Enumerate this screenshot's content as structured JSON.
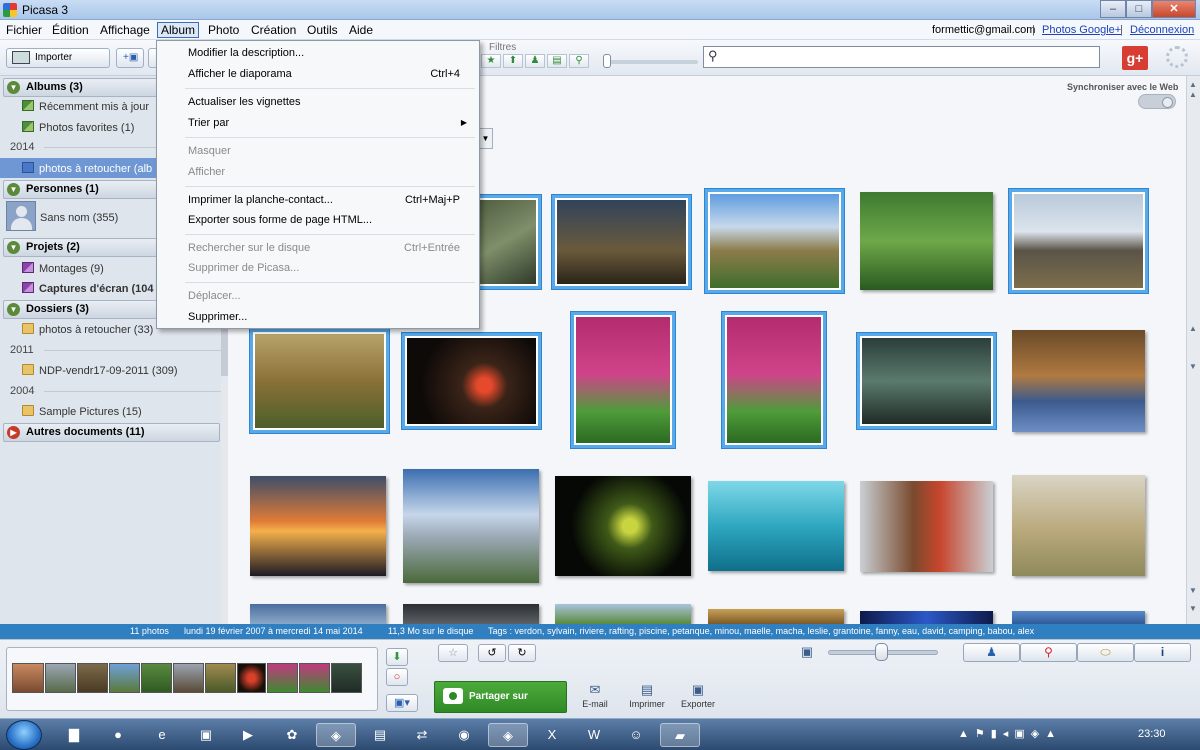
{
  "window": {
    "title": "Picasa 3"
  },
  "menubar": {
    "items": [
      "Fichier",
      "Édition",
      "Affichage",
      "Album",
      "Photo",
      "Création",
      "Outils",
      "Aide"
    ],
    "account_email": "formettic@gmail.com",
    "photos_google_link": "Photos Google+",
    "separator": "|",
    "logout_link": "Déconnexion"
  },
  "toolbar": {
    "import_label": "Importer",
    "filters_label": "Filtres",
    "search_placeholder": ""
  },
  "album_menu": {
    "items": [
      {
        "label": "Modifier la description...",
        "shortcut": "",
        "disabled": false
      },
      {
        "label": "Afficher le diaporama",
        "shortcut": "Ctrl+4",
        "disabled": false
      },
      {
        "label": "Actualiser les vignettes",
        "shortcut": "",
        "disabled": false
      },
      {
        "label": "Trier par",
        "shortcut": "",
        "disabled": false,
        "submenu": true
      },
      {
        "label": "Masquer",
        "shortcut": "",
        "disabled": true
      },
      {
        "label": "Afficher",
        "shortcut": "",
        "disabled": true
      },
      {
        "label": "Imprimer la planche-contact...",
        "shortcut": "Ctrl+Maj+P",
        "disabled": false
      },
      {
        "label": "Exporter sous forme de page HTML...",
        "shortcut": "",
        "disabled": false
      },
      {
        "label": "Rechercher sur le disque",
        "shortcut": "Ctrl+Entrée",
        "disabled": true
      },
      {
        "label": "Supprimer de Picasa...",
        "shortcut": "",
        "disabled": true
      },
      {
        "label": "Déplacer...",
        "shortcut": "",
        "disabled": true
      },
      {
        "label": "Supprimer...",
        "shortcut": "",
        "disabled": false
      }
    ]
  },
  "sidebar": {
    "albums_header": "Albums (3)",
    "albums": [
      "Récemment mis à jour",
      "Photos favorites (1)"
    ],
    "year_2014": "2014",
    "selected_album": "photos à retoucher (alb",
    "people_header": "Personnes (1)",
    "person": "Sans nom (355)",
    "projects_header": "Projets (2)",
    "projects": [
      "Montages (9)",
      "Captures d'écran (104"
    ],
    "folders_header": "Dossiers (3)",
    "folder_1": "photos à retoucher (33)",
    "year_2011": "2011",
    "folder_2": "NDP-vendr17-09-2011 (309)",
    "year_2004": "2004",
    "folder_3": "Sample Pictures (15)",
    "other_header": "Autres documents (11)"
  },
  "main": {
    "sync_label": "Synchroniser avec le Web"
  },
  "statusbar": {
    "count": "11 photos",
    "dates": "lundi 19 février 2007 à mercredi 14 mai 2014",
    "size": "11,3 Mo sur le disque",
    "tags": "Tags : verdon, sylvain, riviere, rafting, piscine, petanque, minou, maelle, macha, leslie, grantoine, fanny, eau, david, camping, babou, alex"
  },
  "tray": {
    "share_label": "Partager sur Google+",
    "email_label": "E-mail",
    "print_label": "Imprimer",
    "export_label": "Exporter"
  },
  "taskbar": {
    "clock": "23:30"
  },
  "colors": {
    "selection": "#2f83d2",
    "statusbar": "#2f7fc1",
    "share_green": "#3a9a2e"
  }
}
